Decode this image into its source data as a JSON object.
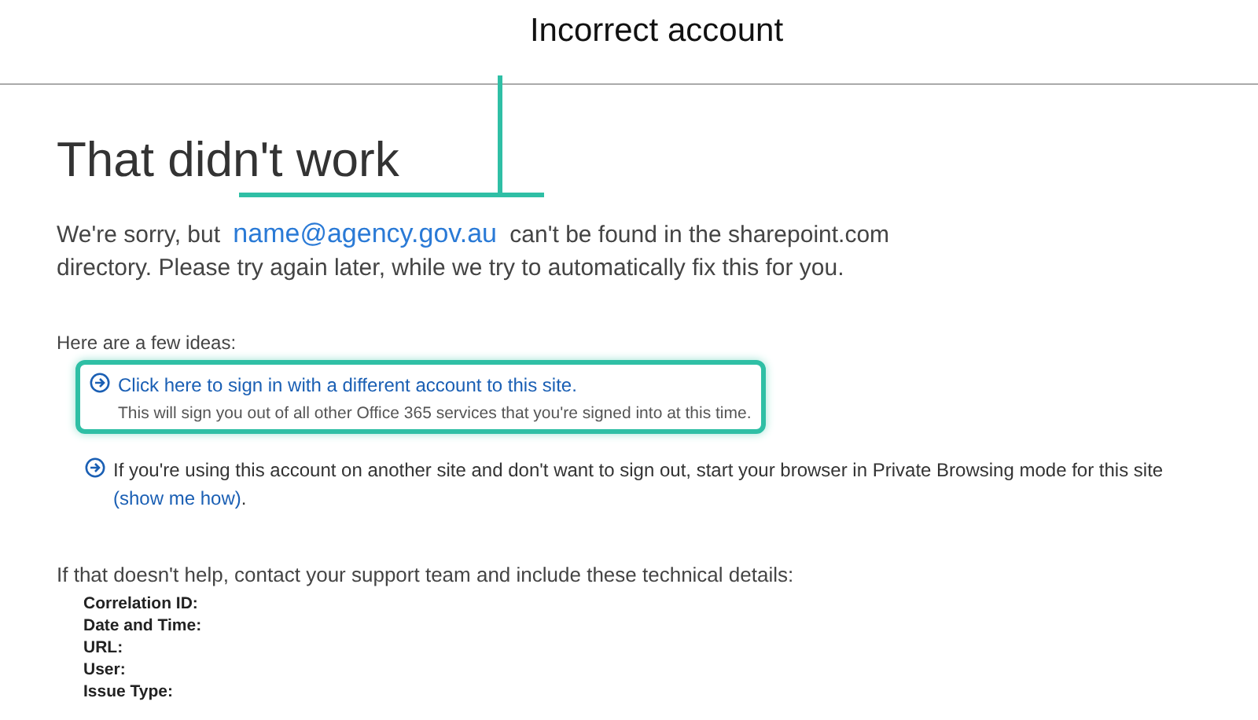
{
  "callout": {
    "label": "Incorrect account"
  },
  "heading": "That didn't work",
  "message": {
    "before": "We're sorry, but",
    "email": "name@agency.gov.au",
    "after": "can't be found in the sharepoint.com directory. Please try again later, while we try to automatically fix this for you."
  },
  "ideas_title": "Here are a few ideas:",
  "ideas": [
    {
      "kind": "link",
      "highlighted": true,
      "link": "Click here to sign in with a different account to this site.",
      "note": "This will sign you out of all other Office 365 services that you're signed into at this time."
    },
    {
      "kind": "text",
      "highlighted": false,
      "text": "If you're using this account on another site and don't want to sign out, start your browser in Private Browsing mode for this site",
      "link": "(show me how)",
      "after": "."
    }
  ],
  "help": "If that doesn't help, contact your support team and include these technical details:",
  "details": [
    "Correlation ID:",
    "Date and Time:",
    "URL:",
    "User:",
    "Issue Type:"
  ]
}
